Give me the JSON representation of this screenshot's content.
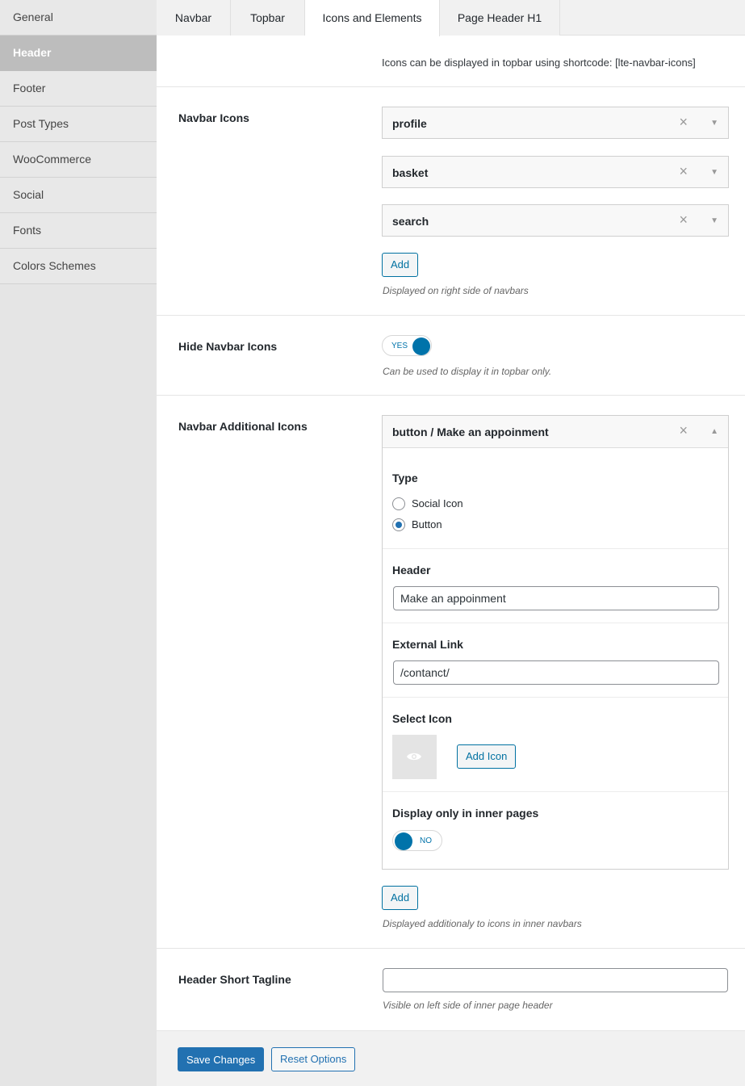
{
  "sidebar": {
    "items": [
      {
        "label": "General",
        "active": false
      },
      {
        "label": "Header",
        "active": true
      },
      {
        "label": "Footer",
        "active": false
      },
      {
        "label": "Post Types",
        "active": false
      },
      {
        "label": "WooCommerce",
        "active": false
      },
      {
        "label": "Social",
        "active": false
      },
      {
        "label": "Fonts",
        "active": false
      },
      {
        "label": "Colors Schemes",
        "active": false
      }
    ]
  },
  "tabs": [
    {
      "label": "Navbar",
      "active": false
    },
    {
      "label": "Topbar",
      "active": false
    },
    {
      "label": "Icons and Elements",
      "active": true
    },
    {
      "label": "Page Header H1",
      "active": false
    }
  ],
  "notice": "Icons can be displayed in topbar using shortcode: [lte-navbar-icons]",
  "navbar_icons": {
    "label": "Navbar Icons",
    "items": [
      "profile",
      "basket",
      "search"
    ],
    "add_label": "Add",
    "hint": "Displayed on right side of navbars"
  },
  "hide_navbar_icons": {
    "label": "Hide Navbar Icons",
    "toggle_text": "YES",
    "hint": "Can be used to display it in topbar only."
  },
  "additional_icons": {
    "label": "Navbar Additional Icons",
    "item_title": "button / Make an appoinment",
    "type_label": "Type",
    "type_options": [
      "Social Icon",
      "Button"
    ],
    "type_selected": "Button",
    "header_label": "Header",
    "header_value": "Make an appoinment",
    "link_label": "External Link",
    "link_value": "/contanct/",
    "select_icon_label": "Select Icon",
    "add_icon_label": "Add Icon",
    "inner_pages_label": "Display only in inner pages",
    "inner_pages_toggle": "NO",
    "add_label": "Add",
    "hint": "Displayed additionaly to icons in inner navbars"
  },
  "tagline": {
    "label": "Header Short Tagline",
    "value": "",
    "hint": "Visible on left side of inner page header"
  },
  "footer": {
    "save_label": "Save Changes",
    "reset_label": "Reset Options"
  },
  "colors": {
    "accent": "#2271b1",
    "toggle": "#0073aa",
    "sidebar_active": "#bdbdbd"
  }
}
